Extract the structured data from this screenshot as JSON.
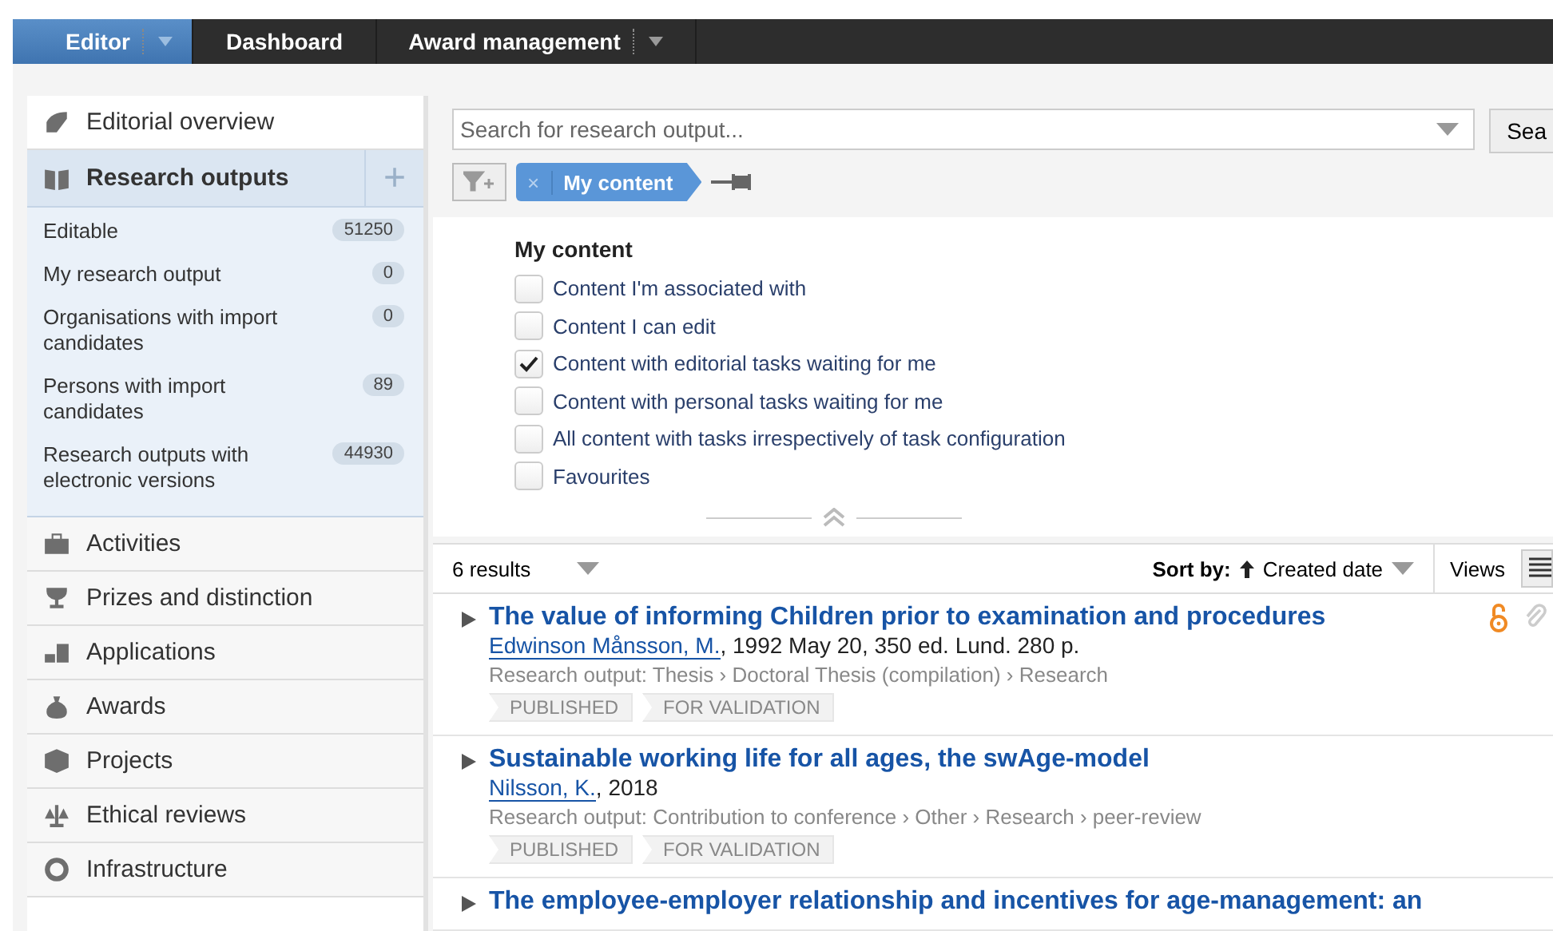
{
  "nav": {
    "tabs": [
      {
        "label": "Editor",
        "selected": true,
        "has_menu": true
      },
      {
        "label": "Dashboard",
        "selected": false,
        "has_menu": false
      },
      {
        "label": "Award management",
        "selected": false,
        "has_menu": true
      }
    ]
  },
  "sidebar": {
    "items": [
      {
        "label": "Editorial overview",
        "expanded": false
      },
      {
        "label": "Research outputs",
        "expanded": true,
        "add": "+",
        "children": [
          {
            "label": "Editable",
            "count": "51250"
          },
          {
            "label": "My research output",
            "count": "0"
          },
          {
            "label": "Organisations with import candidates",
            "count": "0"
          },
          {
            "label": "Persons with import candidates",
            "count": "89"
          },
          {
            "label": "Research outputs with electronic versions",
            "count": "44930"
          }
        ]
      },
      {
        "label": "Activities",
        "expanded": false
      },
      {
        "label": "Prizes and distinction",
        "expanded": false
      },
      {
        "label": "Applications",
        "expanded": false
      },
      {
        "label": "Awards",
        "expanded": false
      },
      {
        "label": "Projects",
        "expanded": false
      },
      {
        "label": "Ethical reviews",
        "expanded": false
      },
      {
        "label": "Infrastructure",
        "expanded": false
      }
    ]
  },
  "search": {
    "placeholder": "Search for research output...",
    "button": "Sea"
  },
  "filter_chip": {
    "remove": "×",
    "label": "My content"
  },
  "filter_panel": {
    "heading": "My content",
    "options": [
      {
        "label": "Content I'm associated with",
        "checked": false
      },
      {
        "label": "Content I can edit",
        "checked": false
      },
      {
        "label": "Content with editorial tasks waiting for me",
        "checked": true
      },
      {
        "label": "Content with personal tasks waiting for me",
        "checked": false
      },
      {
        "label": "All content with tasks irrespectively of task configuration",
        "checked": false
      },
      {
        "label": "Favourites",
        "checked": false
      }
    ]
  },
  "results_bar": {
    "count": "6 results",
    "sort_label": "Sort by:",
    "sort_value": "Created date",
    "views": "Views"
  },
  "results": [
    {
      "title": "The value of informing Children prior to examination and procedures",
      "author": "Edwinson Månsson, M.",
      "details": ", 1992 May 20, 350 ed. Lund. 280 p.",
      "type": "Research output: Thesis › Doctoral Thesis (compilation) › Research",
      "tags": [
        "PUBLISHED",
        "FOR VALIDATION"
      ],
      "open_access": true,
      "attachment": true
    },
    {
      "title": "Sustainable working life for all ages, the swAge-model",
      "author": "Nilsson, K.",
      "details": ", 2018",
      "type": "Research output: Contribution to conference › Other › Research › peer-review",
      "tags": [
        "PUBLISHED",
        "FOR VALIDATION"
      ],
      "open_access": false,
      "attachment": false
    },
    {
      "title": "The employee-employer relationship and incentives for age-management: an",
      "open_access": false,
      "attachment": false
    }
  ]
}
